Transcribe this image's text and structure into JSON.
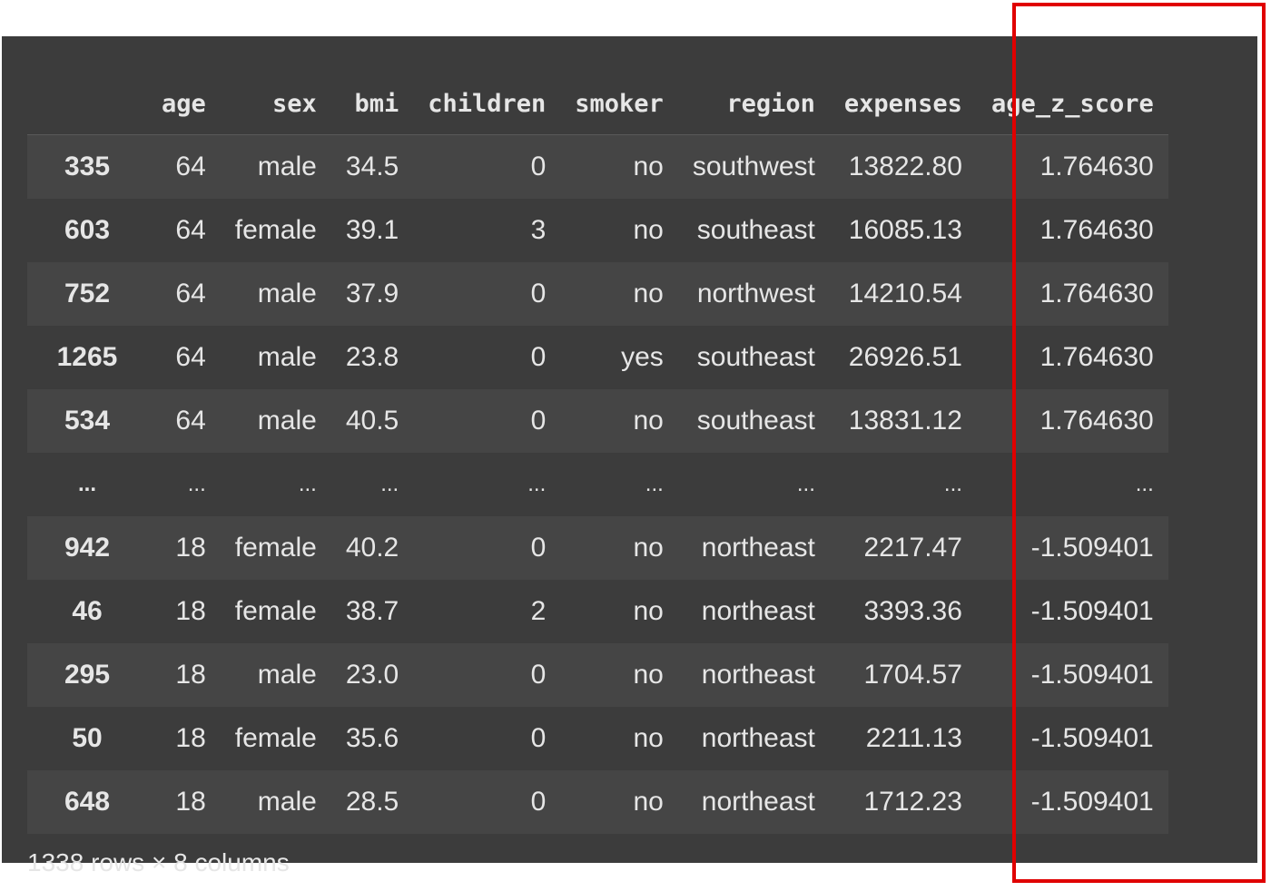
{
  "table": {
    "columns": [
      "",
      "age",
      "sex",
      "bmi",
      "children",
      "smoker",
      "region",
      "expenses",
      "age_z_score"
    ],
    "rows": [
      [
        "335",
        "64",
        "male",
        "34.5",
        "0",
        "no",
        "southwest",
        "13822.80",
        "1.764630"
      ],
      [
        "603",
        "64",
        "female",
        "39.1",
        "3",
        "no",
        "southeast",
        "16085.13",
        "1.764630"
      ],
      [
        "752",
        "64",
        "male",
        "37.9",
        "0",
        "no",
        "northwest",
        "14210.54",
        "1.764630"
      ],
      [
        "1265",
        "64",
        "male",
        "23.8",
        "0",
        "yes",
        "southeast",
        "26926.51",
        "1.764630"
      ],
      [
        "534",
        "64",
        "male",
        "40.5",
        "0",
        "no",
        "southeast",
        "13831.12",
        "1.764630"
      ],
      [
        "...",
        "...",
        "...",
        "...",
        "...",
        "...",
        "...",
        "...",
        "..."
      ],
      [
        "942",
        "18",
        "female",
        "40.2",
        "0",
        "no",
        "northeast",
        "2217.47",
        "-1.509401"
      ],
      [
        "46",
        "18",
        "female",
        "38.7",
        "2",
        "no",
        "northeast",
        "3393.36",
        "-1.509401"
      ],
      [
        "295",
        "18",
        "male",
        "23.0",
        "0",
        "no",
        "northeast",
        "1704.57",
        "-1.509401"
      ],
      [
        "50",
        "18",
        "female",
        "35.6",
        "0",
        "no",
        "northeast",
        "2211.13",
        "-1.509401"
      ],
      [
        "648",
        "18",
        "male",
        "28.5",
        "0",
        "no",
        "northeast",
        "1712.23",
        "-1.509401"
      ]
    ],
    "footer": "1338 rows × 8 columns"
  },
  "highlight": {
    "column": "age_z_score",
    "color": "#e00000"
  },
  "colors": {
    "background": "#3c3c3c",
    "row_alt": "#454545",
    "text": "#e6e6e6"
  }
}
